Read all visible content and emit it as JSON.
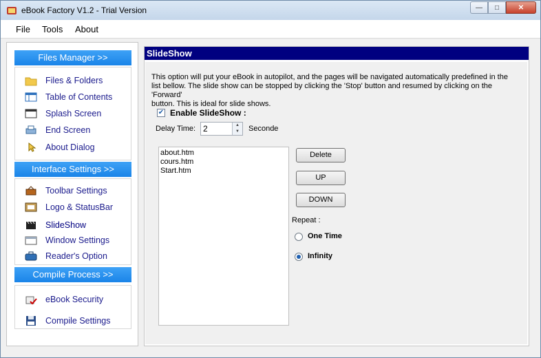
{
  "window": {
    "title": "eBook Factory  V1.2 - Trial Version"
  },
  "menu": [
    "File",
    "Tools",
    "About"
  ],
  "sidebar": {
    "files_manager": {
      "header": "Files Manager >>",
      "items": [
        "Files & Folders",
        "Table of Contents",
        "Splash Screen",
        "End Screen",
        "About Dialog"
      ]
    },
    "interface_settings": {
      "header": "Interface Settings >>",
      "items": [
        "Toolbar Settings",
        "Logo & StatusBar",
        "SlideShow",
        "Window Settings",
        "Reader's Option"
      ]
    },
    "compile_process": {
      "header": "Compile Process >>",
      "items": [
        "eBook Security",
        "Compile Settings"
      ]
    }
  },
  "panel": {
    "title": "SlideShow",
    "description_lines": [
      "This option will put your eBook in autopilot, and the pages will be navigated automatically predefined in the",
      " list bellow. The slide show can be  stopped by clicking the 'Stop' button and resumed by clicking on the 'Forward'",
      "button. This is ideal for slide shows."
    ],
    "enable_label": "Enable SlideShow  :",
    "enable_checked": true,
    "delay_label": "Delay Time:",
    "delay_value": "2",
    "delay_unit": "Seconde",
    "pages": [
      "about.htm",
      "cours.htm",
      "Start.htm"
    ],
    "buttons": {
      "delete": "Delete",
      "up": "UP",
      "down": "DOWN"
    },
    "repeat_label": "Repeat :",
    "repeat_options": [
      "One Time",
      "Infinity"
    ],
    "repeat_selected": "Infinity"
  },
  "colors": {
    "section_header": "#1a84e8",
    "panel_title_bg": "#000080",
    "link_text": "#1a1a8c"
  }
}
